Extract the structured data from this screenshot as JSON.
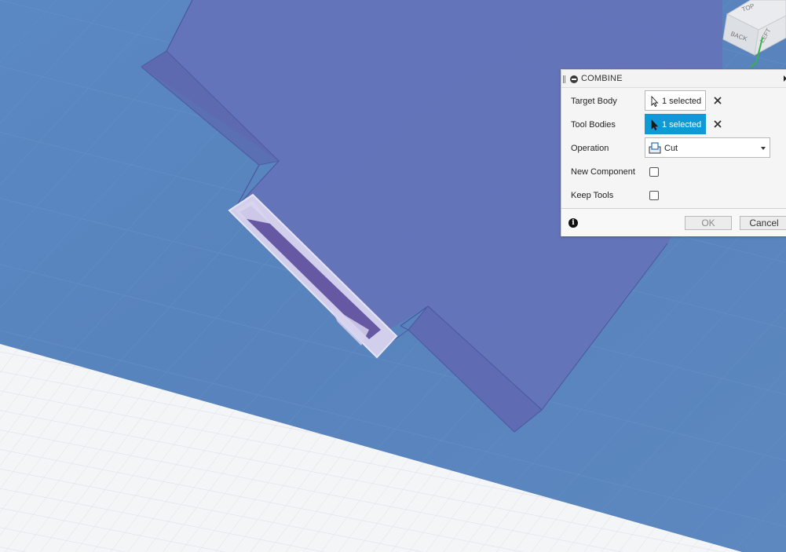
{
  "viewcube": {
    "face_top": "TOP",
    "face_back": "BACK",
    "face_left": "LEFT"
  },
  "dialog": {
    "title": "COMBINE",
    "target_body": {
      "label": "Target Body",
      "value": "1 selected"
    },
    "tool_bodies": {
      "label": "Tool Bodies",
      "value": "1 selected"
    },
    "operation": {
      "label": "Operation",
      "value": "Cut"
    },
    "new_component": {
      "label": "New Component",
      "checked": false
    },
    "keep_tools": {
      "label": "Keep Tools",
      "checked": false
    },
    "ok_label": "OK",
    "cancel_label": "Cancel",
    "accent_color": "#0e9ad7"
  },
  "colors": {
    "ground": "#5a87c0",
    "body": "#6672b8",
    "tool_body": "#5b4a9c",
    "grid_background": "#f4f5f7"
  },
  "icons": [
    "minus-icon",
    "cursor-icon",
    "clear-icon",
    "cut-icon",
    "dropdown-arrow-icon",
    "info-icon",
    "expand-icon"
  ]
}
